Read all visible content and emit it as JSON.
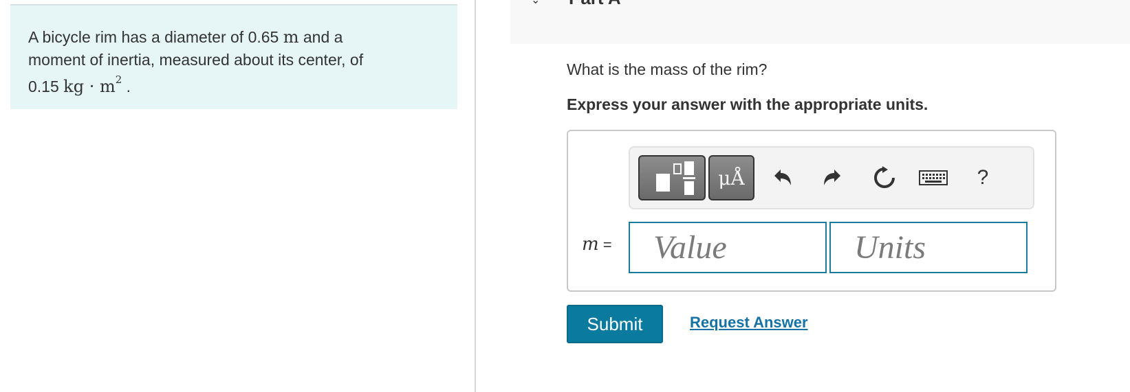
{
  "problem": {
    "line1_pre": "A bicycle rim has a diameter of 0.65 ",
    "line1_unit": "m",
    "line1_post": " and a",
    "line2": "moment of inertia, measured about its center, of",
    "line3_value": "0.15 ",
    "line3_unit": "kg · m",
    "line3_exp": "2",
    "line3_post": " ."
  },
  "part": {
    "title": "Part A"
  },
  "question": "What is the mass of the rim?",
  "instruction": "Express your answer with the appropriate units.",
  "toolbar": {
    "templates_icon": "fraction-templates-icon",
    "symbols_label": "μÅ",
    "undo_icon": "undo-icon",
    "redo_icon": "redo-icon",
    "reset_icon": "reset-icon",
    "keyboard_icon": "keyboard-icon",
    "help_label": "?"
  },
  "answer": {
    "variable": "m",
    "equals": " =",
    "value_placeholder": "Value",
    "units_placeholder": "Units"
  },
  "actions": {
    "submit_label": "Submit",
    "request_label": "Request Answer"
  },
  "colors": {
    "problem_bg": "#e6f5f5",
    "accent": "#0a7a9e",
    "link": "#1672a4",
    "input_border": "#1a7a9c"
  }
}
